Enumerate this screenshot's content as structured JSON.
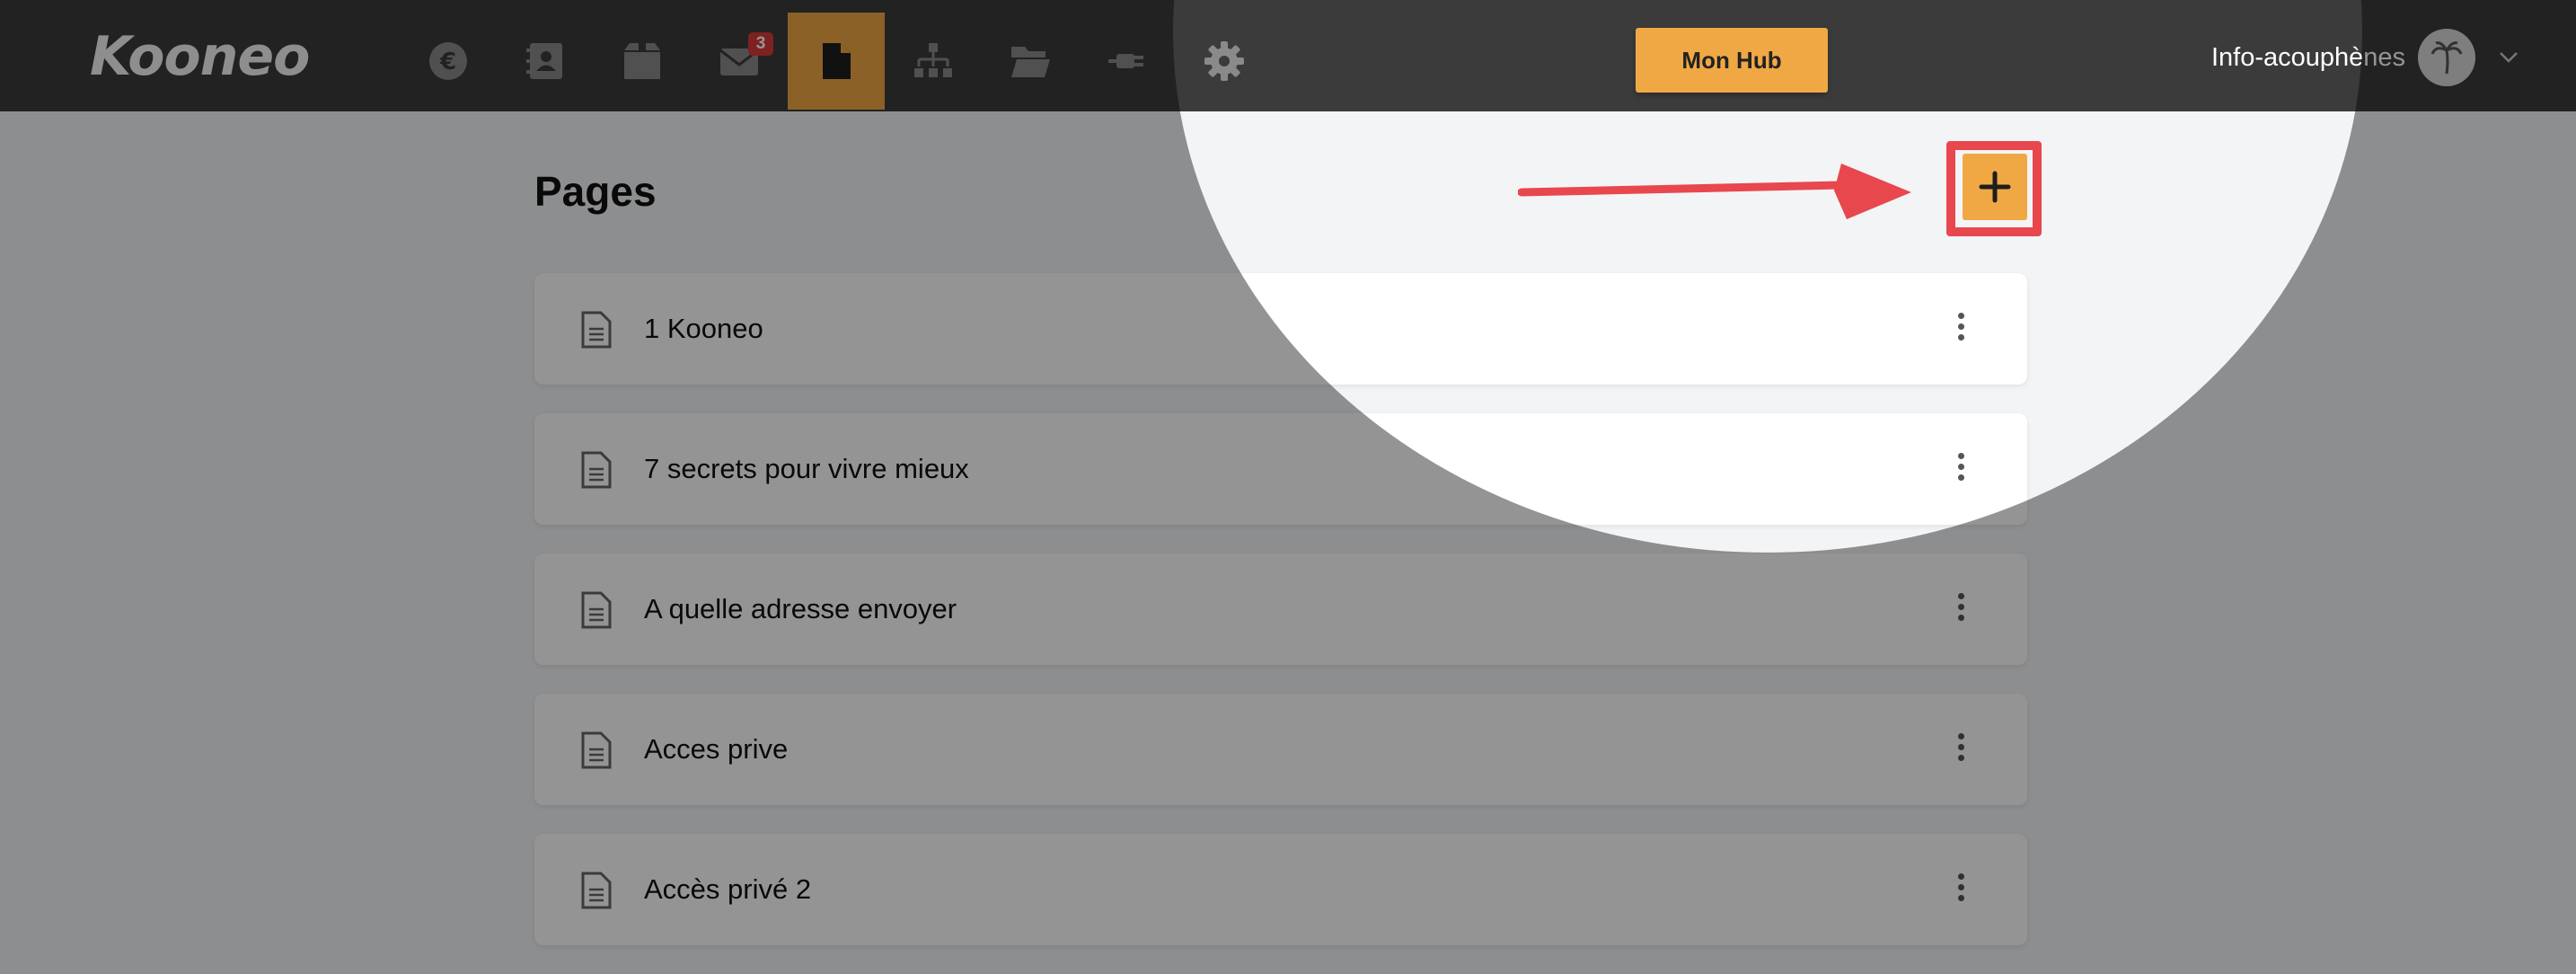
{
  "brand": {
    "logo_text": "Kooneo"
  },
  "nav": {
    "items": [
      {
        "icon": "euro-icon",
        "badge": null,
        "active": false
      },
      {
        "icon": "contacts-icon",
        "badge": null,
        "active": false
      },
      {
        "icon": "box-icon",
        "badge": null,
        "active": false
      },
      {
        "icon": "mail-icon",
        "badge": "3",
        "active": false
      },
      {
        "icon": "page-icon",
        "badge": null,
        "active": true
      },
      {
        "icon": "sitemap-icon",
        "badge": null,
        "active": false
      },
      {
        "icon": "folder-icon",
        "badge": null,
        "active": false
      },
      {
        "icon": "plug-icon",
        "badge": null,
        "active": false
      },
      {
        "icon": "gear-icon",
        "badge": null,
        "active": false
      }
    ]
  },
  "header": {
    "hub_label": "Mon Hub",
    "account_name": "Info-acouphènes"
  },
  "main": {
    "title": "Pages",
    "pages": [
      {
        "label": "1 Kooneo"
      },
      {
        "label": "7 secrets pour vivre mieux"
      },
      {
        "label": "A quelle adresse envoyer"
      },
      {
        "label": "Acces prive"
      },
      {
        "label": "Accès privé 2"
      }
    ]
  },
  "colors": {
    "topbar": "#3b3b3b",
    "accent": "#f0a845",
    "annotation": "#e8474e",
    "badge": "#d93a3a"
  }
}
